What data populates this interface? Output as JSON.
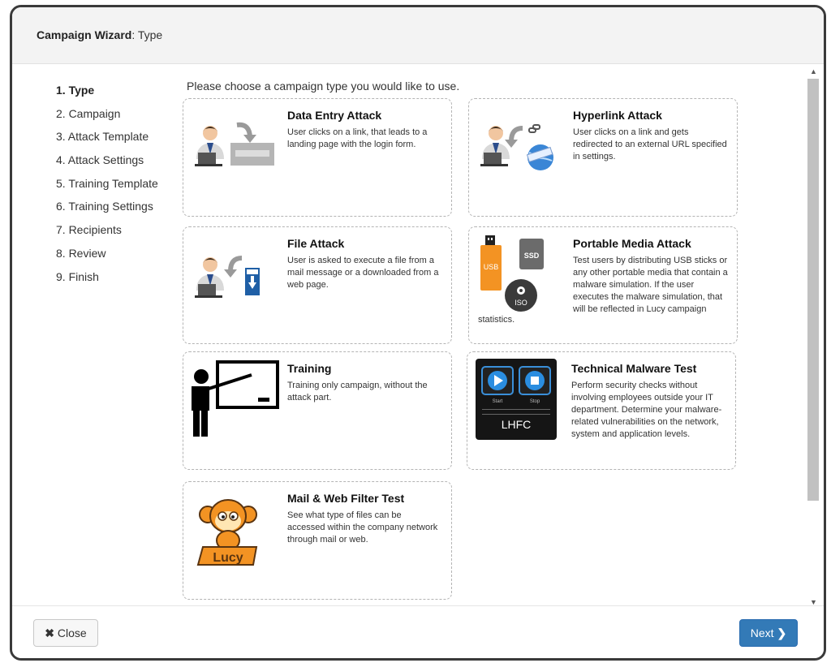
{
  "header": {
    "title_bold": "Campaign Wizard",
    "title_rest": ": Type"
  },
  "steps": [
    {
      "label": "1. Type"
    },
    {
      "label": "2. Campaign"
    },
    {
      "label": "3. Attack Template"
    },
    {
      "label": "4. Attack Settings"
    },
    {
      "label": "5. Training Template"
    },
    {
      "label": "6. Training Settings"
    },
    {
      "label": "7. Recipients"
    },
    {
      "label": "8. Review"
    },
    {
      "label": "9. Finish"
    }
  ],
  "intro": "Please choose a campaign type you would like to use.",
  "cards": [
    {
      "title": "Data Entry Attack",
      "desc": "User clicks on a link, that leads to a landing page with the login form.",
      "icon": "data-entry-icon"
    },
    {
      "title": "Hyperlink Attack",
      "desc": "User clicks on a link and gets redirected to an external URL specified in settings.",
      "icon": "hyperlink-icon"
    },
    {
      "title": "File Attack",
      "desc": "User is asked to execute a file from a mail message or a downloaded from a web page.",
      "icon": "file-attack-icon"
    },
    {
      "title": "Portable Media Attack",
      "desc": "Test users by distributing USB sticks or any other portable media that contain a malware simulation. If the user executes the malware simulation, that will be reflected in Lucy campaign",
      "desc_tail": "statistics.",
      "icon": "portable-media-icon",
      "icon_labels": {
        "usb": "USB",
        "ssd": "SSD",
        "iso": "ISO"
      }
    },
    {
      "title": "Training",
      "desc": "Training only campaign, without the attack part.",
      "icon": "training-icon"
    },
    {
      "title": "Technical Malware Test",
      "desc": "Perform security checks without involving employees outside your IT department. Determine your malware-related vulnerabilities on the network, system and application levels.",
      "icon": "lhfc-icon",
      "icon_labels": {
        "start": "Start",
        "stop": "Stop",
        "brand": "LHFC"
      }
    },
    {
      "title": "Mail & Web Filter Test",
      "desc": "See what type of files can be accessed within the company network through mail or web.",
      "icon": "lucy-mascot-icon",
      "icon_labels": {
        "brand": "Lucy"
      }
    }
  ],
  "footer": {
    "close_label": "Close",
    "next_label": "Next"
  },
  "colors": {
    "primary": "#337ab7",
    "accent_orange": "#f39323",
    "header_bg": "#f3f3f3"
  }
}
